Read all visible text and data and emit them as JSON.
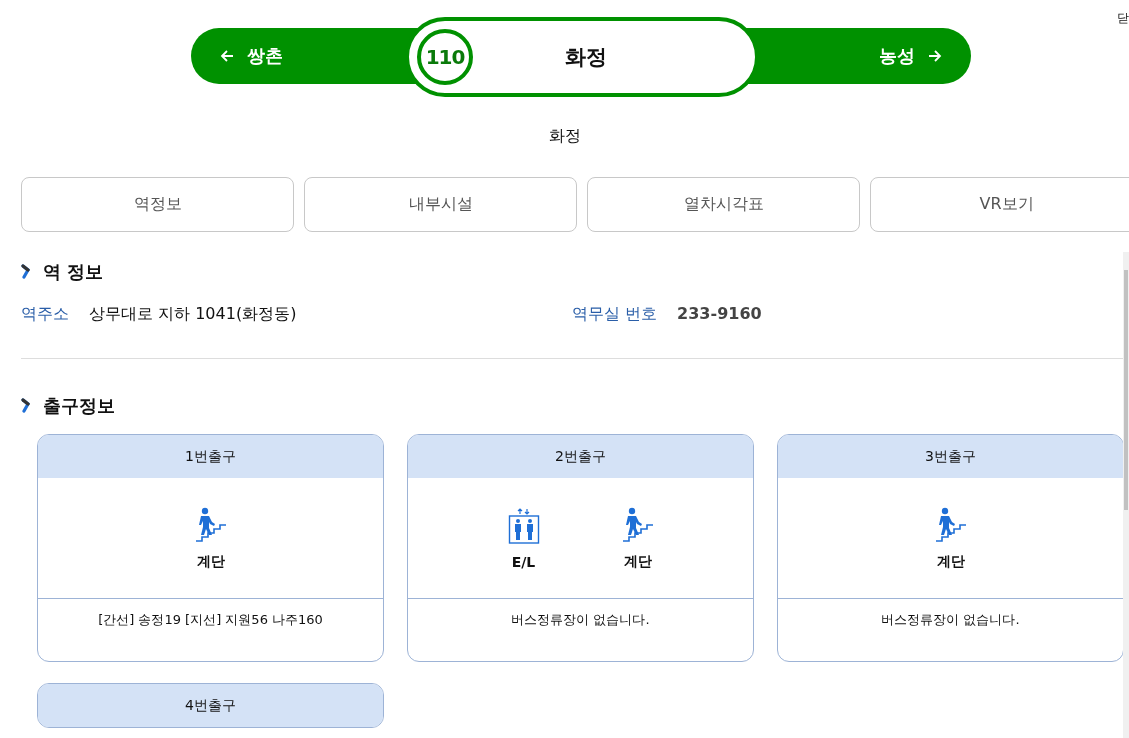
{
  "close_label": "닫",
  "line_bar": {
    "prev_station": "쌍촌",
    "station_number": "110",
    "station_name": "화정",
    "next_station": "농성"
  },
  "page_title": "화정",
  "tabs": [
    {
      "label": "역정보",
      "selected": false
    },
    {
      "label": "내부시설",
      "selected": false
    },
    {
      "label": "열차시각표",
      "selected": false
    },
    {
      "label": "VR보기",
      "selected": false
    }
  ],
  "station_info": {
    "heading": "역 정보",
    "address_label": "역주소",
    "address": "상무대로 지하 1041(화정동)",
    "phone_label": "역무실 번호",
    "phone": "233-9160"
  },
  "exits": {
    "heading": "출구정보",
    "items": [
      {
        "title": "1번출구",
        "facilities": [
          {
            "kind": "stairs",
            "label": "계단"
          }
        ],
        "bus_info": "[간선] 송정19 [지선] 지원56 나주160"
      },
      {
        "title": "2번출구",
        "facilities": [
          {
            "kind": "elevator",
            "label": "E/L"
          },
          {
            "kind": "stairs",
            "label": "계단"
          }
        ],
        "bus_info": "버스정류장이 없습니다."
      },
      {
        "title": "3번출구",
        "facilities": [
          {
            "kind": "stairs",
            "label": "계단"
          }
        ],
        "bus_info": "버스정류장이 없습니다."
      },
      {
        "title": "4번출구"
      }
    ]
  }
}
